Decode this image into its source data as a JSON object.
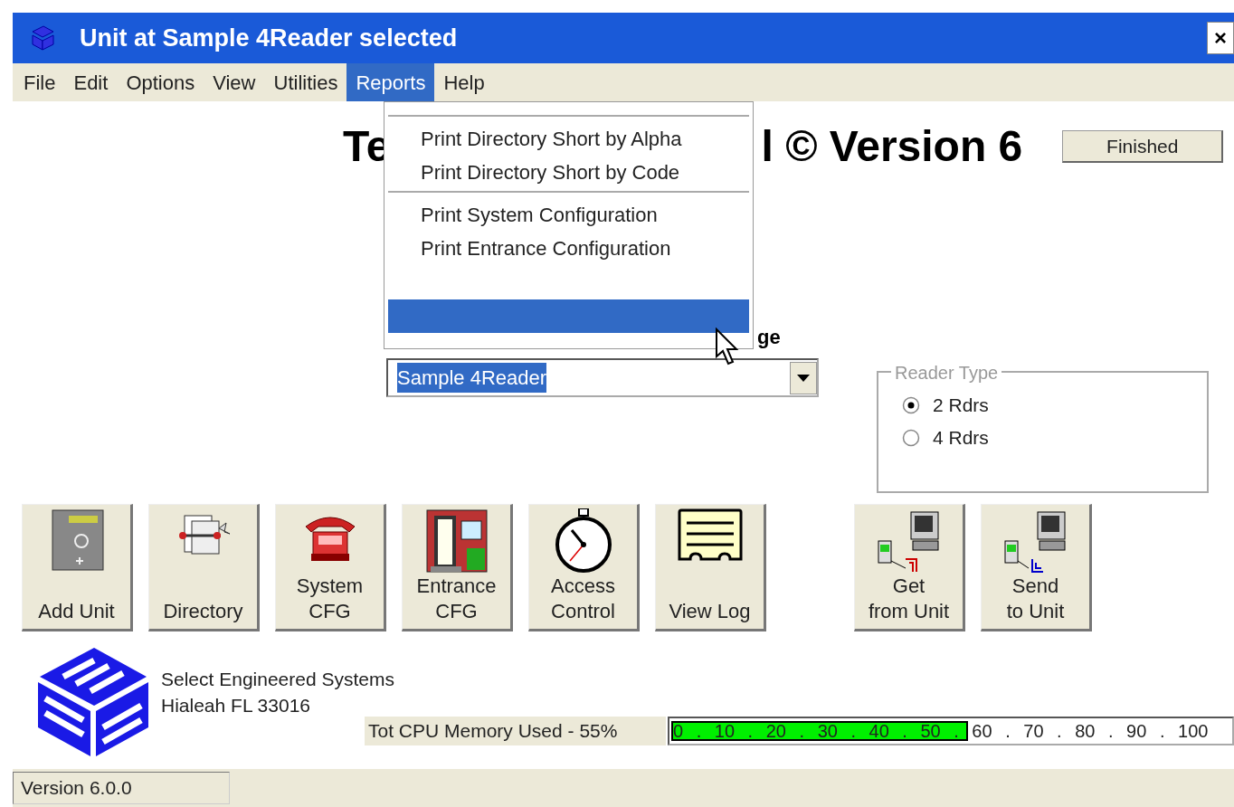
{
  "window": {
    "title": "Unit at Sample 4Reader selected",
    "close_button": "×"
  },
  "menu_bar": [
    {
      "label": "File",
      "selected": false
    },
    {
      "label": "Edit",
      "selected": false
    },
    {
      "label": "Options",
      "selected": false
    },
    {
      "label": "View",
      "selected": false
    },
    {
      "label": "Utilities",
      "selected": false
    },
    {
      "label": "Reports",
      "selected": true
    },
    {
      "label": "Help",
      "selected": false
    }
  ],
  "reports_menu": [
    {
      "kind": "separator"
    },
    {
      "kind": "item",
      "label": "Print Directory Short by Alpha",
      "selected": false
    },
    {
      "kind": "item",
      "label": "Print Directory Short by Code",
      "selected": false
    },
    {
      "kind": "separator"
    },
    {
      "kind": "item",
      "label": "Print System Configuration",
      "selected": false
    },
    {
      "kind": "item",
      "label": "Print Entrance Configuration",
      "selected": false
    },
    {
      "kind": "blank"
    },
    {
      "kind": "item",
      "selected": true
    }
  ],
  "heading": {
    "left": "Te",
    "right": "l © Version 6"
  },
  "finished_button": "Finished",
  "unit_label_end": "ge",
  "unit_select": {
    "value": "Sample 4Reader"
  },
  "reader_type": {
    "title": "Reader Type",
    "options": [
      {
        "label": "2 Rdrs",
        "selected": true
      },
      {
        "label": "4 Rdrs",
        "selected": false
      }
    ]
  },
  "toolbar": [
    {
      "label": "Add  Unit"
    },
    {
      "label": "Directory"
    },
    {
      "label": "System\nCFG"
    },
    {
      "label": "Entrance\nCFG"
    },
    {
      "label": "Access\nControl"
    },
    {
      "label": "View Log"
    },
    {
      "label": "Get\nfrom Unit"
    },
    {
      "label": "Send\nto Unit"
    }
  ],
  "company": {
    "name": "Select Engineered Systems",
    "address": "Hialeah FL 33016"
  },
  "memory": {
    "label": "Tot CPU Memory Used - 55%",
    "level": 0.55,
    "scale": "0 . 10 . 20 . 30 . 40 . 50 . 60 . 70 . 80 . 90 . 100"
  },
  "status_bar": {
    "version": "Version 6.0.0"
  }
}
